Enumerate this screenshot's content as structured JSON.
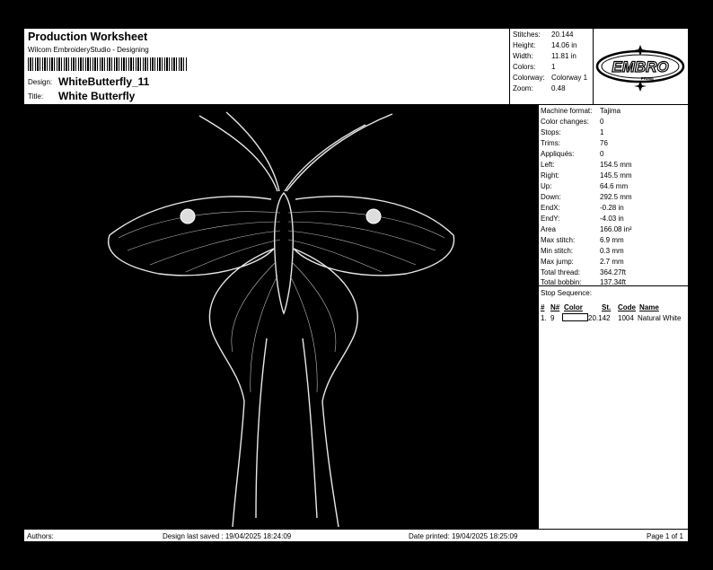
{
  "header": {
    "title": "Production Worksheet",
    "subtitle": "Wilcom EmbroideryStudio - Designing",
    "design_label": "Design:",
    "design_value": "WhiteButterfly_11",
    "title_label": "Title:",
    "title_value": "White Butterfly"
  },
  "summary": [
    {
      "label": "Stitches:",
      "value": "20.144"
    },
    {
      "label": "Height:",
      "value": "14.06 in"
    },
    {
      "label": "Width:",
      "value": "11.81 in"
    },
    {
      "label": "Colors:",
      "value": "1"
    },
    {
      "label": "Colorway:",
      "value": "Colorway 1"
    },
    {
      "label": "Zoom:",
      "value": "0.48"
    }
  ],
  "logo": {
    "text": "EMBRO",
    "subtext": "PRIME"
  },
  "stats": [
    {
      "label": "Machine format:",
      "value": "Tajima"
    },
    {
      "label": "Color changes:",
      "value": "0"
    },
    {
      "label": "Stops:",
      "value": "1"
    },
    {
      "label": "Trims:",
      "value": "76"
    },
    {
      "label": "Appliqués:",
      "value": "0"
    },
    {
      "label": "Left:",
      "value": "154.5 mm"
    },
    {
      "label": "Right:",
      "value": "145.5 mm"
    },
    {
      "label": "Up:",
      "value": "64.6 mm"
    },
    {
      "label": "Down:",
      "value": "292.5 mm"
    },
    {
      "label": "EndX:",
      "value": "-0.28 in"
    },
    {
      "label": "EndY:",
      "value": "-4.03 in"
    },
    {
      "label": "Area",
      "value": "166.08 in²"
    },
    {
      "label": "Max stitch:",
      "value": "6.9 mm"
    },
    {
      "label": "Min stitch:",
      "value": "0.3 mm"
    },
    {
      "label": "Max jump:",
      "value": "2.7 mm"
    },
    {
      "label": "Total thread:",
      "value": "364.27ft"
    },
    {
      "label": "Total bobbin:",
      "value": "137.34ft"
    }
  ],
  "stop_sequence": {
    "title": "Stop Sequence:",
    "headers": {
      "num": "#",
      "n": "N#",
      "color": "Color",
      "st": "St.",
      "code": "Code",
      "name": "Name"
    },
    "rows": [
      {
        "num": "1.",
        "n": "9",
        "st": "20.142",
        "code": "1004",
        "name": "Natural White",
        "color": "#ffffff"
      }
    ]
  },
  "footer": {
    "authors": "Authors:",
    "saved": "Design last saved : 19/04/2025 18:24:09",
    "printed": "Date printed: 19/04/2025 18:25:09",
    "page": "Page 1 of 1"
  }
}
